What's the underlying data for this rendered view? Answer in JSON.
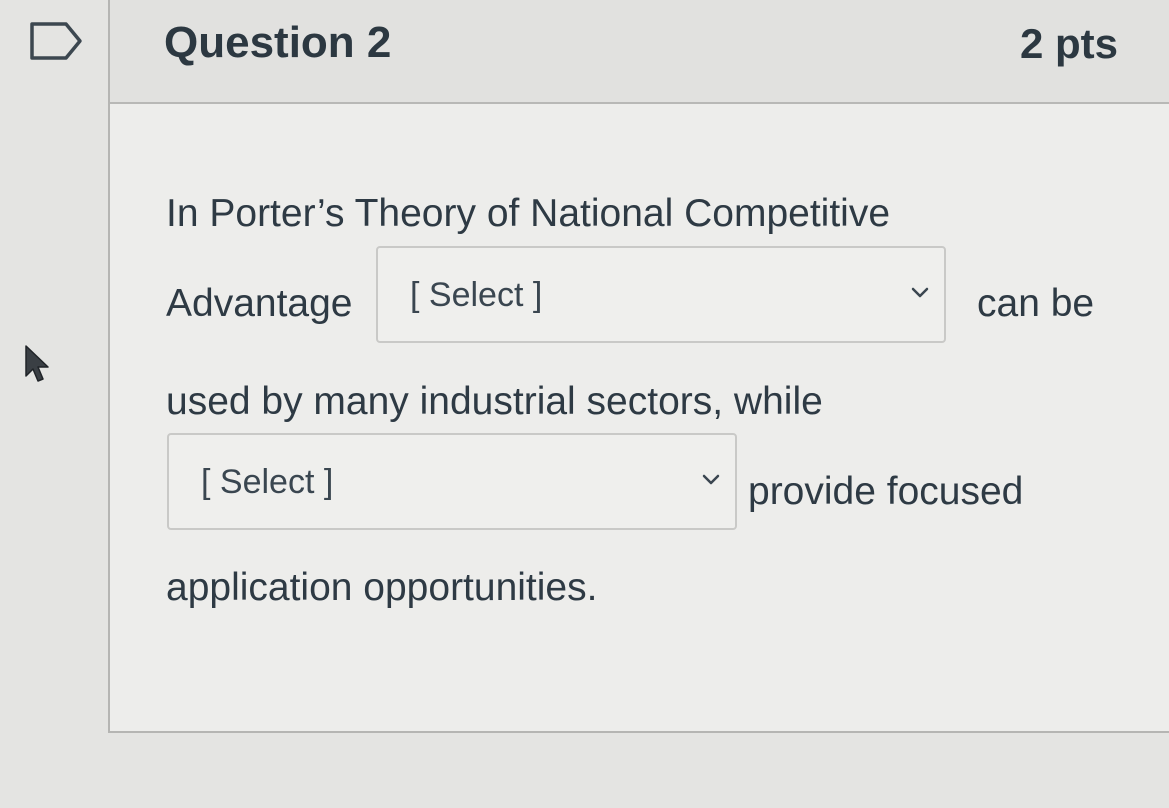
{
  "question": {
    "title": "Question 2",
    "points": "2 pts",
    "text_line1": "In Porter’s Theory of National Competitive",
    "text_advantage": "Advantage",
    "text_can_be": "can be",
    "text_line3": "used by many industrial sectors, while",
    "text_provide": "provide focused",
    "text_line5": "application opportunities.",
    "select_1": {
      "selected": "[ Select ]"
    },
    "select_2": {
      "selected": "[ Select ]"
    }
  },
  "icons": {
    "flag": "flag-outline-icon",
    "cursor": "mouse-pointer-icon",
    "dropdown": "chevron-down-icon"
  },
  "colors": {
    "text": "#2d3b45",
    "background": "#e4e4e2",
    "header_background": "#e1e1df",
    "border": "#b5b5b3"
  }
}
